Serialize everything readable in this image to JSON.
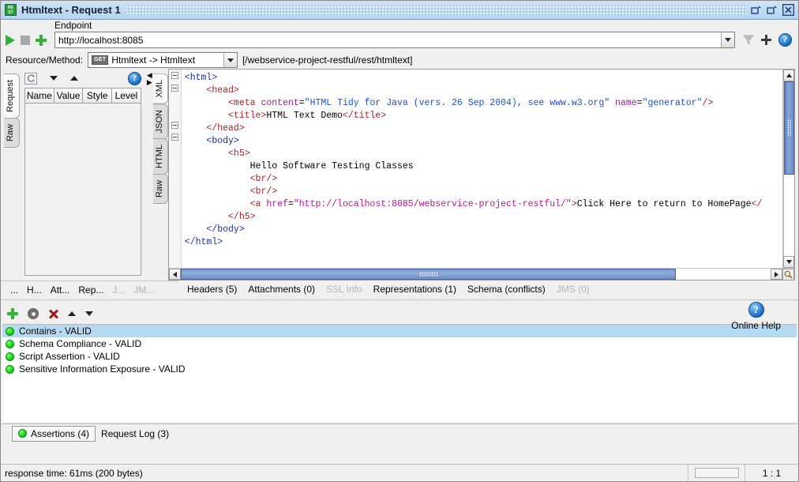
{
  "window": {
    "title": "Htmltext - Request 1",
    "app_icon": "rest-icon",
    "buttons": [
      {
        "name": "restore-down-button",
        "icon": "restore-icon"
      },
      {
        "name": "maximize-button",
        "icon": "maximize-icon"
      },
      {
        "name": "close-button",
        "icon": "close-icon"
      }
    ]
  },
  "toolbar": {
    "run_label": "Submit Request",
    "stop_label": "Cancel Request",
    "add_label": "Add Endpoint",
    "endpoint_label": "Endpoint",
    "endpoint_value": "http://localhost:8085",
    "filter_icon": "filter-icon",
    "plus_icon": "plus-icon",
    "help_icon": "help-icon"
  },
  "resource": {
    "label": "Resource/Method:",
    "method_badge": "GET",
    "method_value": "Htmltext -> Htmltext",
    "path": "[/webservice-project-restful/rest/htmltext]"
  },
  "request_panel": {
    "vtabs": [
      {
        "label": "Request",
        "selected": true
      },
      {
        "label": "Raw",
        "selected": false
      }
    ],
    "toolbar": {
      "refresh_icon": "refresh-icon",
      "move_down_icon": "chevron-down-icon",
      "move_up_icon": "chevron-up-icon",
      "help_icon": "help-icon"
    },
    "table_headers": [
      "Name",
      "Value",
      "Style",
      "Level"
    ],
    "table_rows": [],
    "tabs": [
      {
        "label": "...",
        "enabled": true
      },
      {
        "label": "H...",
        "enabled": true
      },
      {
        "label": "Att...",
        "enabled": true
      },
      {
        "label": "Rep...",
        "enabled": true
      },
      {
        "label": "J...",
        "enabled": false
      },
      {
        "label": "JM...",
        "enabled": false
      }
    ]
  },
  "response_panel": {
    "vtabs": [
      {
        "label": "XML",
        "selected": true
      },
      {
        "label": "JSON",
        "selected": false
      },
      {
        "label": "HTML",
        "selected": false
      },
      {
        "label": "Raw",
        "selected": false
      }
    ],
    "code_lines": [
      [
        {
          "t": "<html>",
          "c": "tagb"
        }
      ],
      [
        {
          "t": "    ",
          "c": "txt"
        },
        {
          "t": "<head>",
          "c": "tag"
        }
      ],
      [
        {
          "t": "        ",
          "c": "txt"
        },
        {
          "t": "<meta ",
          "c": "tag"
        },
        {
          "t": "content",
          "c": "attr"
        },
        {
          "t": "=",
          "c": "txt"
        },
        {
          "t": "\"HTML Tidy for Java (vers. 26 Sep 2004), see www.w3.org\"",
          "c": "str"
        },
        {
          "t": " name",
          "c": "attr"
        },
        {
          "t": "=",
          "c": "txt"
        },
        {
          "t": "\"generator\"",
          "c": "str"
        },
        {
          "t": "/>",
          "c": "tag"
        }
      ],
      [
        {
          "t": "        ",
          "c": "txt"
        },
        {
          "t": "<title>",
          "c": "tag"
        },
        {
          "t": "HTML Text Demo",
          "c": "txt"
        },
        {
          "t": "</title>",
          "c": "tag"
        }
      ],
      [
        {
          "t": "    ",
          "c": "txt"
        },
        {
          "t": "</head>",
          "c": "tag"
        }
      ],
      [
        {
          "t": "    ",
          "c": "txt"
        },
        {
          "t": "<body>",
          "c": "tagb"
        }
      ],
      [
        {
          "t": "        ",
          "c": "txt"
        },
        {
          "t": "<h5>",
          "c": "tag"
        }
      ],
      [
        {
          "t": "            ",
          "c": "txt"
        },
        {
          "t": "Hello Software Testing Classes",
          "c": "txt"
        }
      ],
      [
        {
          "t": "            ",
          "c": "txt"
        },
        {
          "t": "<br/>",
          "c": "tag"
        }
      ],
      [
        {
          "t": "            ",
          "c": "txt"
        },
        {
          "t": "<br/>",
          "c": "tag"
        }
      ],
      [
        {
          "t": "            ",
          "c": "txt"
        },
        {
          "t": "<a ",
          "c": "tag"
        },
        {
          "t": "href",
          "c": "attr"
        },
        {
          "t": "=",
          "c": "txt"
        },
        {
          "t": "\"http://localhost:8085/webservice-project-restful/\"",
          "c": "str2"
        },
        {
          "t": ">",
          "c": "tag"
        },
        {
          "t": "Click Here to return to HomePage",
          "c": "txt"
        },
        {
          "t": "</",
          "c": "tag"
        }
      ],
      [
        {
          "t": "        ",
          "c": "txt"
        },
        {
          "t": "</h5>",
          "c": "tag"
        }
      ],
      [
        {
          "t": "    ",
          "c": "txt"
        },
        {
          "t": "</body>",
          "c": "tagb"
        }
      ],
      [
        {
          "t": "",
          "c": "txt"
        },
        {
          "t": "</html>",
          "c": "tagb"
        }
      ]
    ],
    "tabs": [
      {
        "label": "Headers (5)",
        "enabled": true
      },
      {
        "label": "Attachments (0)",
        "enabled": true
      },
      {
        "label": "SSL Info",
        "enabled": false
      },
      {
        "label": "Representations (1)",
        "enabled": true
      },
      {
        "label": "Schema (conflicts)",
        "enabled": true
      },
      {
        "label": "JMS (0)",
        "enabled": false
      }
    ]
  },
  "assertions": {
    "toolbar": {
      "add_icon": "plus-icon",
      "configure_icon": "gear-icon",
      "delete_icon": "close-x-icon",
      "move_up_icon": "chevron-up-icon",
      "move_down_icon": "chevron-down-icon"
    },
    "online_help": {
      "label": "Online Help",
      "icon": "help-icon"
    },
    "rows": [
      {
        "label": "Contains - VALID",
        "status": "valid",
        "selected": true
      },
      {
        "label": "Schema Compliance - VALID",
        "status": "valid",
        "selected": false
      },
      {
        "label": "Script Assertion - VALID",
        "status": "valid",
        "selected": false
      },
      {
        "label": "Sensitive Information Exposure - VALID",
        "status": "valid",
        "selected": false
      }
    ]
  },
  "bottom_tabs": [
    {
      "label": "Assertions (4)",
      "selected": true,
      "status": "valid"
    },
    {
      "label": "Request Log (3)",
      "selected": false,
      "status": null
    }
  ],
  "statusbar": {
    "message": "response time: 61ms (200 bytes)",
    "ratio": "1 : 1"
  },
  "colors": {
    "accent": "#b8d9f2",
    "title_bar": "#bcd7f0",
    "valid_green": "#0ec40e",
    "run_green": "#35b03b",
    "tag_red": "#a0252a",
    "tag_blue": "#1b2f9e",
    "attr_purple": "#9b1f8f",
    "string_blue": "#1f51c4"
  }
}
